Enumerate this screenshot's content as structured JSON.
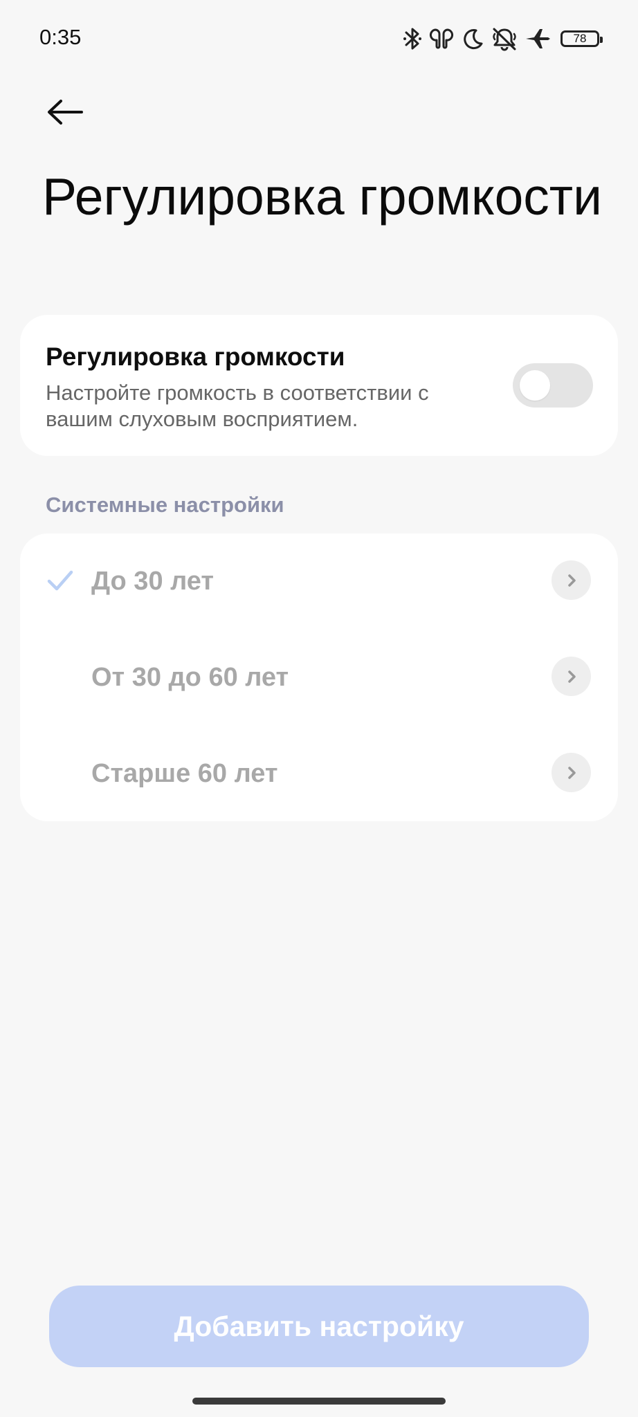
{
  "status_bar": {
    "time": "0:35",
    "icons": [
      "bluetooth-icon",
      "earbuds-icon",
      "moon-icon",
      "bell-off-icon",
      "airplane-icon"
    ],
    "battery": "78"
  },
  "header": {
    "back_icon": "arrow-left-icon",
    "title": "Регулировка громкости"
  },
  "volume_adjust": {
    "title": "Регулировка громкости",
    "description": "Настройте громкость в соответствии с вашим слуховым восприятием.",
    "enabled": false
  },
  "system_settings": {
    "header": "Системные настройки",
    "items": [
      {
        "label": "До 30 лет",
        "selected": true
      },
      {
        "label": "От 30 до 60 лет",
        "selected": false
      },
      {
        "label": "Старше 60 лет",
        "selected": false
      }
    ]
  },
  "footer": {
    "add_button_label": "Добавить настройку"
  },
  "colors": {
    "background": "#f7f7f7",
    "card": "#ffffff",
    "accent_check": "#b9cff4",
    "button": "#c3d2f6",
    "section_header": "#8b8fa8",
    "disabled_text": "#a8a8a8"
  }
}
